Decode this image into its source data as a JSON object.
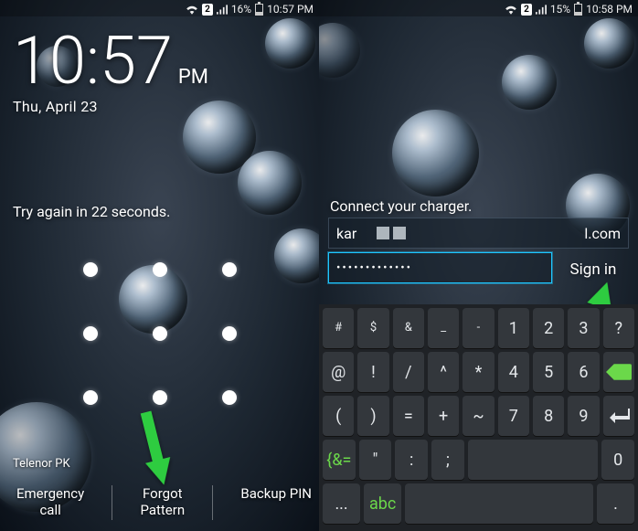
{
  "left": {
    "status": {
      "sim": "2",
      "battery_pct": "16%",
      "time": "10:57 PM"
    },
    "clock": {
      "time": "10:57",
      "ampm": "PM",
      "date": "Thu, April 23"
    },
    "try_msg": "Try again in 22 seconds.",
    "carrier": "Telenor PK",
    "buttons": {
      "emergency": "Emergency\ncall",
      "forgot": "Forgot\nPattern",
      "backup": "Backup PIN"
    }
  },
  "right": {
    "status": {
      "sim": "2",
      "battery_pct": "15%",
      "time": "10:58 PM"
    },
    "connect_msg": "Connect your charger.",
    "email_prefix": "kar",
    "email_suffix": "l.com",
    "password_mask": "•••••••••••••",
    "sign_in": "Sign in",
    "keys": {
      "row1": [
        "#",
        "$",
        "&",
        "_",
        "-",
        "1",
        "2",
        "3",
        "?"
      ],
      "row2": [
        "@",
        "!",
        "/",
        "^",
        "*",
        "4",
        "5",
        "6"
      ],
      "row3": [
        "(",
        ")",
        "=",
        "+",
        "~",
        "7",
        "8",
        "9"
      ],
      "row4_shift": "{&=",
      "row4": [
        "\"",
        ":",
        ";",
        "0"
      ],
      "row5_lang": "...",
      "row5_abc": "abc",
      "row5_dot": ".",
      "row1_top": [
        "",
        "",
        "",
        "",
        "",
        "",
        "",
        "",
        ""
      ]
    }
  }
}
